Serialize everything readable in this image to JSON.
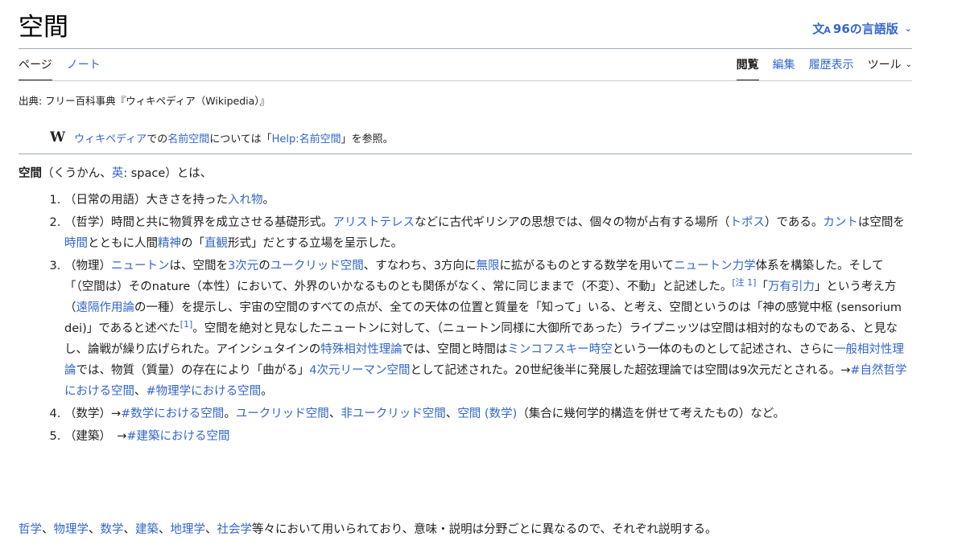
{
  "header": {
    "title": "空間",
    "languages_label": "96の言語版",
    "lang_icon": "translate-icon"
  },
  "tabs": {
    "left": [
      {
        "label": "ページ",
        "selected": true
      },
      {
        "label": "ノート",
        "selected": false
      }
    ],
    "right": [
      {
        "label": "閲覧",
        "selected": true
      },
      {
        "label": "編集",
        "selected": false
      },
      {
        "label": "履歴表示",
        "selected": false
      }
    ],
    "tools_label": "ツール"
  },
  "source_line": "出典: フリー百科事典『ウィキペディア（Wikipedia）』",
  "hatnote": {
    "icon_text": "W",
    "link1": "ウィキペディア",
    "text1": "での",
    "link2": "名前空間",
    "text2": "については「",
    "link3": "Help:名前空間",
    "text3": "」を参照。"
  },
  "intro": {
    "bold_term": "空間",
    "text1": "（くうかん、",
    "link_lang": "英",
    "text2": ": space）とは、"
  },
  "defs": {
    "d1": {
      "t1": "（日常の用語）大きさを持った",
      "l1": "入れ物",
      "t2": "。"
    },
    "d2": {
      "t1": "（哲学）時間と共に物質界を成立させる基礎形式。",
      "l1": "アリストテレス",
      "t2": "などに古代ギリシアの思想では、個々の物が占有する場所（",
      "l2": "トポス",
      "t3": "）である。",
      "l3": "カント",
      "t4": "は空間を",
      "l4": "時間",
      "t5": "とともに人間",
      "l5": "精神",
      "t6": "の「",
      "l6": "直観",
      "t7": "形式」だとする立場を呈示した。"
    },
    "d3": {
      "t1": "（物理）",
      "l1": "ニュートン",
      "t2": "は、空間を",
      "l2": "3次元",
      "t3": "の",
      "l3": "ユークリッド空間",
      "t4": "、すなわち、3方向に",
      "l4": "無限",
      "t5": "に拡がるものとする数学を用いて",
      "l5": "ニュートン力学",
      "t6": "体系を構築した。そして「（空間は）そのnature（本性）において、外界のいかなるものとも関係がなく、常に同じままで（不変）、不動」と記述した。",
      "r1": "[注 1]",
      "t7": "「",
      "l6": "万有引力",
      "t8": "」という考え方（",
      "l7": "遠隔作用論",
      "t9": "の一種）を提示し、宇宙の空間のすべての点が、全ての天体の位置と質量を「知って」いる、と考え、空間というのは「神の感覚中枢 (sensorium dei)」であると述べた",
      "r2": "[1]",
      "t10": "。空間を絶対と見なしたニュートンに対して、（ニュートン同様に大御所であった）ライプニッツは空間は相対的なものである、と見なし、論戦が繰り広げられた。アインシュタインの",
      "l8": "特殊相対性理論",
      "t11": "では、空間と時間は",
      "l9": "ミンコフスキー時空",
      "t12": "という一体のものとして記述され、さらに",
      "l10": "一般相対性理論",
      "t13": "では、物質（質量）の存在により「曲がる」",
      "l11": "4次元リーマン空間",
      "t14": "として記述された。20世紀後半に発展した超弦理論では空間は9次元だとされる。→",
      "l12": "#自然哲学における空間",
      "t15": "、",
      "l13": "#物理学における空間",
      "t16": "。"
    },
    "d4": {
      "t1": "（数学）→",
      "l1": "#数学における空間",
      "t2": "。",
      "l2": "ユークリッド空間",
      "t3": "、",
      "l3": "非ユークリッド空間",
      "t4": "、",
      "l4": "空間 (数学)",
      "t5": "（集合に幾何学的構造を併せて考えたもの）など。"
    },
    "d5": {
      "t1": "（建築）　→",
      "l1": "#建築における空間"
    }
  },
  "closing": {
    "l1": "哲学",
    "s1": "、",
    "l2": "物理学",
    "s2": "、",
    "l3": "数学",
    "s3": "、",
    "l4": "建築",
    "s4": "、",
    "l5": "地理学",
    "s5": "、",
    "l6": "社会学",
    "t1": "等々において用いられており、意味・説明は分野ごとに異なるので、それぞれ説明する。"
  }
}
